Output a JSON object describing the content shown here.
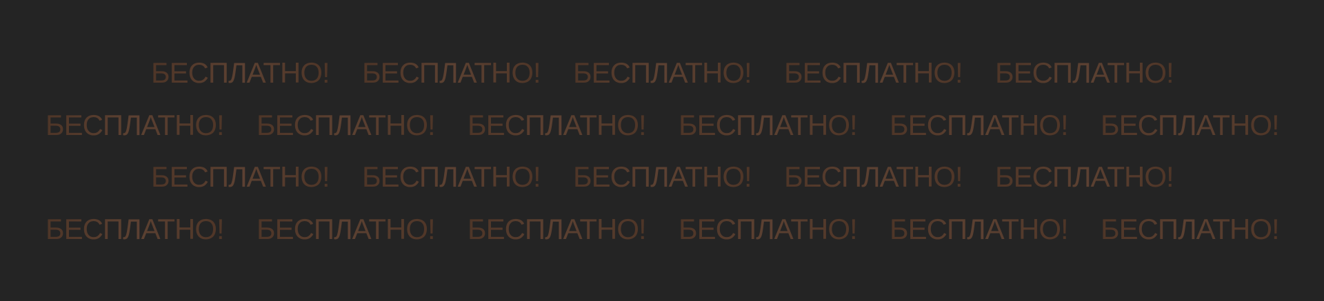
{
  "banner": {
    "text": "БЕСПЛАТНО!",
    "text_color": "#5a3f30",
    "background_color": "#242424"
  }
}
